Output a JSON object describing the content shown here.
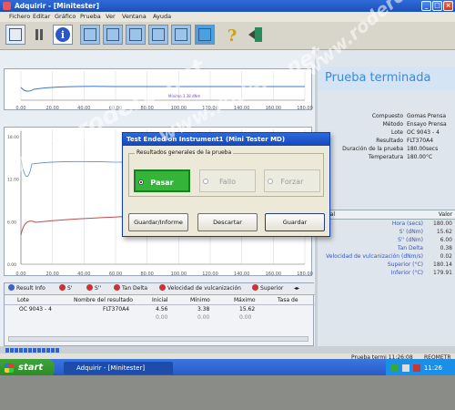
{
  "window": {
    "title": "Adquirir - [Minitester]"
  },
  "menu": [
    "Fichero",
    "Editar",
    "Gráfico",
    "Prueba",
    "Ver",
    "Ventana",
    "Ayuda"
  ],
  "chart_top": {
    "x_ticks": [
      "0.00",
      "20.00",
      "40.00",
      "60.00",
      "80.00",
      "100.00",
      "120.00",
      "140.00",
      "160.00",
      "180.00"
    ],
    "marker_label": "Mínimo 3.38 dNm"
  },
  "chart_bottom": {
    "x_ticks": [
      "0.00",
      "20.00",
      "40.00",
      "60.00",
      "80.00",
      "100.00",
      "120.00",
      "140.00",
      "160.00",
      "180.00"
    ],
    "y_ticks": [
      "0.00",
      "6.00",
      "12.00",
      "18.00"
    ]
  },
  "dialog": {
    "title": "Test Ended on Instrument1 (Mini Tester MD)",
    "group_label": "Resultados generales de la prueba",
    "options": {
      "pass": "Pasar",
      "fail": "Fallo",
      "force": "Forzar"
    },
    "buttons": {
      "save_report": "Guardar/Informe",
      "discard": "Descartar",
      "save": "Guardar"
    }
  },
  "right_panel": {
    "heading": "Prueba terminada",
    "info": [
      {
        "k": "Compuesto",
        "v": "Gomas Prensa"
      },
      {
        "k": "Método",
        "v": "Ensayo Prensa"
      },
      {
        "k": "Lote",
        "v": "OC 9043 - 4"
      },
      {
        "k": "Resultado",
        "v": "FLT370A4"
      },
      {
        "k": "Duración de la prueba",
        "v": "180.00secs"
      },
      {
        "k": "Temperatura",
        "v": "180.00°C"
      }
    ],
    "table_header": {
      "left": "Canal",
      "right": "Valor"
    },
    "values": [
      {
        "k": "Hora (secs)",
        "v": "180.00"
      },
      {
        "k": "S' (dNm)",
        "v": "15.62"
      },
      {
        "k": "S'' (dNm)",
        "v": "6.00"
      },
      {
        "k": "Tan Delta",
        "v": "0.38"
      },
      {
        "k": "Velocidad de vulcanización (dNm/s)",
        "v": "0.02"
      },
      {
        "k": "Superior (°C)",
        "v": "180.14"
      },
      {
        "k": "Inferior (°C)",
        "v": "179.91"
      }
    ]
  },
  "bottom_panel": {
    "tabs": [
      "Result Info",
      "S'",
      "S''",
      "Tan Delta",
      "Velocidad de vulcanización",
      "Superior"
    ],
    "columns": [
      "Lote",
      "Nombre del resultado",
      "Inicial",
      "Mínimo",
      "Máximo",
      "Tasa de"
    ],
    "rows": [
      {
        "lote": "OC 9043 - 4",
        "nombre": "FLT370A4",
        "inicial": "4.56",
        "minimo": "3.38",
        "maximo": "15.62",
        "tasa": ""
      },
      {
        "lote": "",
        "nombre": "",
        "inicial": "0.00",
        "minimo": "0.00",
        "maximo": "0.00",
        "tasa": ""
      }
    ]
  },
  "status": {
    "left": "Prueba termi 11:26:08",
    "right": "REOMETR"
  },
  "taskbar": {
    "start": "start",
    "item": "Adquirir - [Minitester]",
    "clock": "11:26"
  },
  "watermark": "www.rodero.net"
}
